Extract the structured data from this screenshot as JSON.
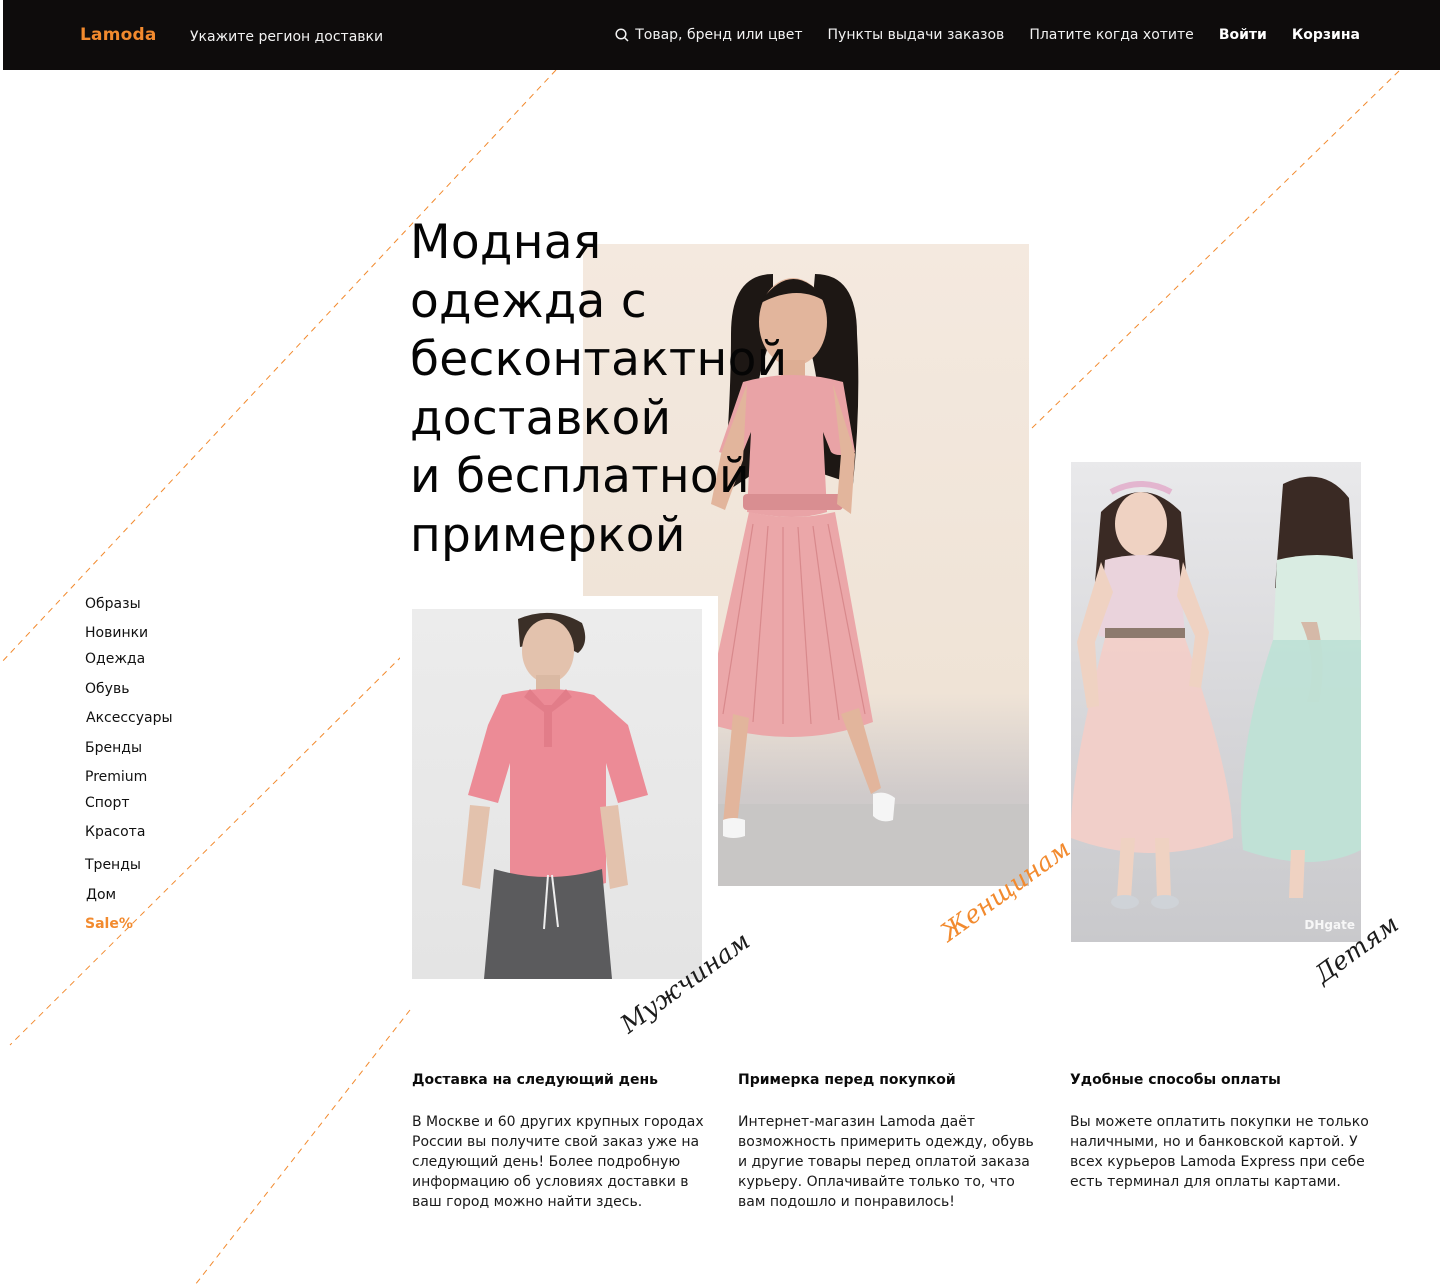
{
  "header": {
    "logo": "Lamoda",
    "region": "Укажите регион доставки",
    "search_label": "Товар, бренд или цвет",
    "pickup_points": "Пункты выдачи заказов",
    "pay_later": "Платите когда хотите",
    "login": "Войти",
    "cart": "Корзина"
  },
  "hero": {
    "title": "Модная\nодежда с\nбесконтактной\nдоставкой\nи бесплатной\nпримеркой"
  },
  "side_menu": [
    {
      "label": "Образы"
    },
    {
      "label": "Новинки"
    },
    {
      "label": "Одежда"
    },
    {
      "label": "Обувь"
    },
    {
      "label": "Аксессуары"
    },
    {
      "label": "Бренды"
    },
    {
      "label": "Premium"
    },
    {
      "label": "Спорт"
    },
    {
      "label": "Красота"
    },
    {
      "label": "Тренды"
    },
    {
      "label": "Дом"
    },
    {
      "label": "Sale%"
    }
  ],
  "categories": {
    "men": "Мужчинам",
    "women": "Женщинам",
    "kids": "Детям"
  },
  "kids_photo_watermark": "DHgate",
  "features": [
    {
      "title": "Доставка на следующий день",
      "text": "В Москве и 60 других крупных городах России вы получите свой заказ уже на следующий день! Более подробную информацию об условиях доставки в ваш город можно найти здесь."
    },
    {
      "title": "Примерка перед покупкой",
      "text": "Интернет-магазин Lamoda даёт возможность примерить одежду, обувь и другие товары перед оплатой заказа курьеру. Оплачивайте только то, что вам подошло и понравилось!"
    },
    {
      "title": "Удобные способы оплаты",
      "text": "Вы можете оплатить покупки не только наличными, но и банковской картой. У всех курьеров Lamoda Express при себе есть терминал для оплаты картами."
    }
  ],
  "colors": {
    "accent": "#f28a2e",
    "header_bg": "#0e0c0c",
    "text": "#111111"
  },
  "icons": {
    "search": "search-icon"
  }
}
